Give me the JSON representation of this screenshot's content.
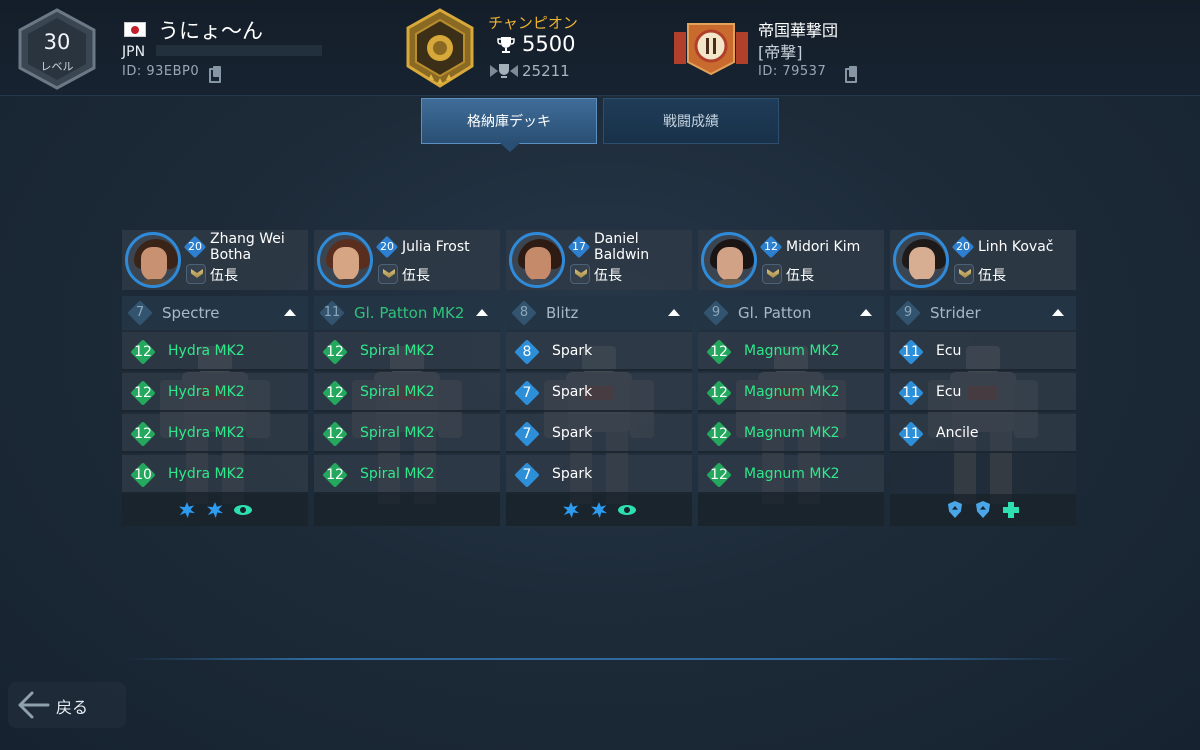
{
  "player": {
    "level": "30",
    "level_label": "レベル",
    "name": "うにょ〜ん",
    "country": "JPN",
    "id": "ID: 93EBP0",
    "flag_icon": "japan-flag-icon"
  },
  "league": {
    "title": "チャンピオン",
    "trophies": "5500",
    "rank": "25211"
  },
  "clan": {
    "name": "帝国華撃団",
    "tag": "[帝撃]",
    "id": "ID: 79537"
  },
  "tabs": [
    {
      "label": "格納庫デッキ",
      "active": true
    },
    {
      "label": "戦闘成績",
      "active": false
    }
  ],
  "columns": [
    {
      "pilot": {
        "name_line1": "Zhang Wei",
        "name_line2": "Botha",
        "level": "20",
        "rank": "伍長"
      },
      "robot": {
        "name": "Spectre",
        "level": "7",
        "name_color": "#a9b8c4"
      },
      "weapons": [
        {
          "level": "12",
          "name": "Hydra MK2",
          "color": "green"
        },
        {
          "level": "12",
          "name": "Hydra MK2",
          "color": "green"
        },
        {
          "level": "12",
          "name": "Hydra MK2",
          "color": "green"
        },
        {
          "level": "10",
          "name": "Hydra MK2",
          "color": "green"
        }
      ],
      "modules": [
        "burst-icon",
        "burst-icon",
        "eye-icon"
      ]
    },
    {
      "pilot": {
        "name_line1": "Julia Frost",
        "name_line2": "",
        "level": "20",
        "rank": "伍長"
      },
      "robot": {
        "name": "Gl. Patton MK2",
        "level": "11",
        "name_color": "#2fc27a"
      },
      "weapons": [
        {
          "level": "12",
          "name": "Spiral MK2",
          "color": "green"
        },
        {
          "level": "12",
          "name": "Spiral MK2",
          "color": "green"
        },
        {
          "level": "12",
          "name": "Spiral MK2",
          "color": "green"
        },
        {
          "level": "12",
          "name": "Spiral MK2",
          "color": "green"
        }
      ],
      "modules": []
    },
    {
      "pilot": {
        "name_line1": "Daniel",
        "name_line2": "Baldwin",
        "level": "17",
        "rank": "伍長"
      },
      "robot": {
        "name": "Blitz",
        "level": "8",
        "name_color": "#a9b8c4"
      },
      "weapons": [
        {
          "level": "8",
          "name": "Spark",
          "color": "blue"
        },
        {
          "level": "7",
          "name": "Spark",
          "color": "blue"
        },
        {
          "level": "7",
          "name": "Spark",
          "color": "blue"
        },
        {
          "level": "7",
          "name": "Spark",
          "color": "blue"
        }
      ],
      "modules": [
        "burst-icon",
        "burst-icon",
        "eye-icon"
      ]
    },
    {
      "pilot": {
        "name_line1": "Midori Kim",
        "name_line2": "",
        "level": "12",
        "rank": "伍長"
      },
      "robot": {
        "name": "Gl. Patton",
        "level": "9",
        "name_color": "#a9b8c4"
      },
      "weapons": [
        {
          "level": "12",
          "name": "Magnum MK2",
          "color": "green"
        },
        {
          "level": "12",
          "name": "Magnum MK2",
          "color": "green"
        },
        {
          "level": "12",
          "name": "Magnum MK2",
          "color": "green"
        },
        {
          "level": "12",
          "name": "Magnum MK2",
          "color": "green"
        }
      ],
      "modules": []
    },
    {
      "pilot": {
        "name_line1": "Linh Kovač",
        "name_line2": "",
        "level": "20",
        "rank": "伍長"
      },
      "robot": {
        "name": "Strider",
        "level": "9",
        "name_color": "#a9b8c4"
      },
      "weapons": [
        {
          "level": "11",
          "name": "Ecu",
          "color": "blue"
        },
        {
          "level": "11",
          "name": "Ecu",
          "color": "blue"
        },
        {
          "level": "11",
          "name": "Ancile",
          "color": "blue"
        }
      ],
      "modules": [
        "shield-icon",
        "shield-icon",
        "plus-icon"
      ]
    }
  ],
  "back": {
    "label": "戻る"
  }
}
